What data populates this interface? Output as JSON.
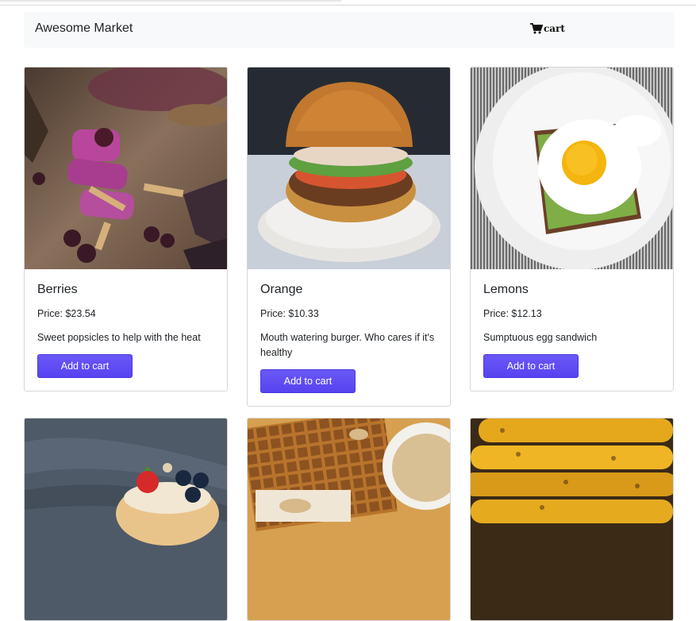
{
  "navbar": {
    "brand": "Awesome Market",
    "cart_label": "cart"
  },
  "products": [
    {
      "name": "Berries",
      "price": "Price: $23.54",
      "description": "Sweet popsicles to help with the heat",
      "button": "Add to cart",
      "image": "purple popsicles with blackberries"
    },
    {
      "name": "Orange",
      "price": "Price: $10.33",
      "description": "Mouth watering burger. Who cares if it's healthy",
      "button": "Add to cart",
      "image": "burger on speckled plate"
    },
    {
      "name": "Lemons",
      "price": "Price: $12.13",
      "description": "Sumptuous egg sandwich",
      "button": "Add to cart",
      "image": "fried egg on avocado toast"
    },
    {
      "image": "pancakes with strawberry and blueberries"
    },
    {
      "image": "waffles with dipping sauce"
    },
    {
      "image": "grilled corn on the cob"
    }
  ],
  "colors": {
    "accent": "#5f4bf5",
    "navbar_bg": "#f8f9fa"
  }
}
